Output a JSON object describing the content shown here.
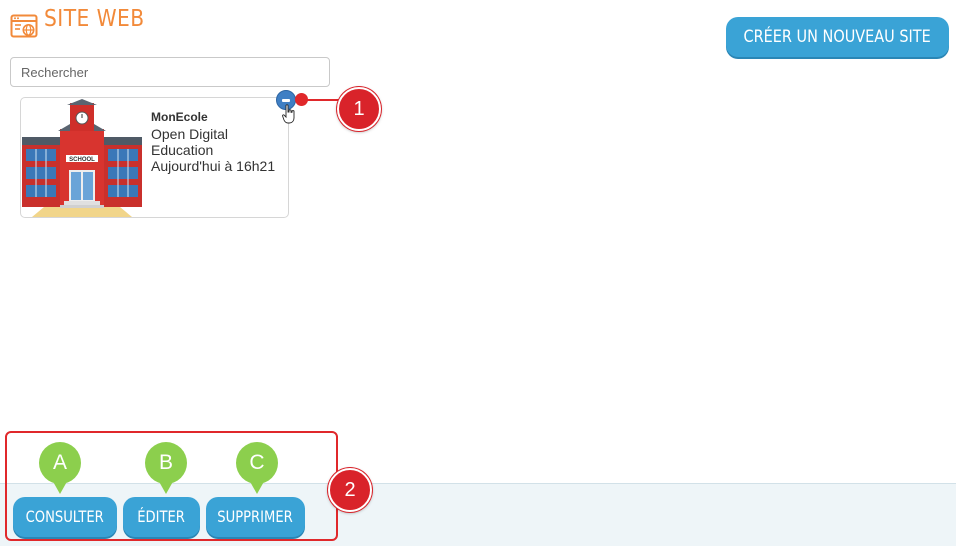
{
  "header": {
    "title": "SITE WEB",
    "create_button_label": "CRÉER UN NOUVEAU SITE",
    "icon": "website-icon"
  },
  "search": {
    "placeholder": "Rechercher",
    "value": ""
  },
  "sites": [
    {
      "name": "MonEcole",
      "owner": "Open Digital Education",
      "owner_line1": "Open Digital",
      "owner_line2": "Education",
      "modified": "Aujourd'hui à 16h21",
      "thumbnail": "school-building-image"
    }
  ],
  "actions": {
    "consult_label": "CONSULTER",
    "edit_label": "ÉDITER",
    "delete_label": "SUPPRIMER"
  },
  "annotations": {
    "callout_1": "1",
    "callout_2": "2",
    "marker_a": "A",
    "marker_b": "B",
    "marker_c": "C"
  },
  "colors": {
    "title": "#f28a3a",
    "button": "#3aa3d6",
    "callout": "#d9232a",
    "marker": "#8ccf4d",
    "action_bar": "#eef5f8"
  }
}
